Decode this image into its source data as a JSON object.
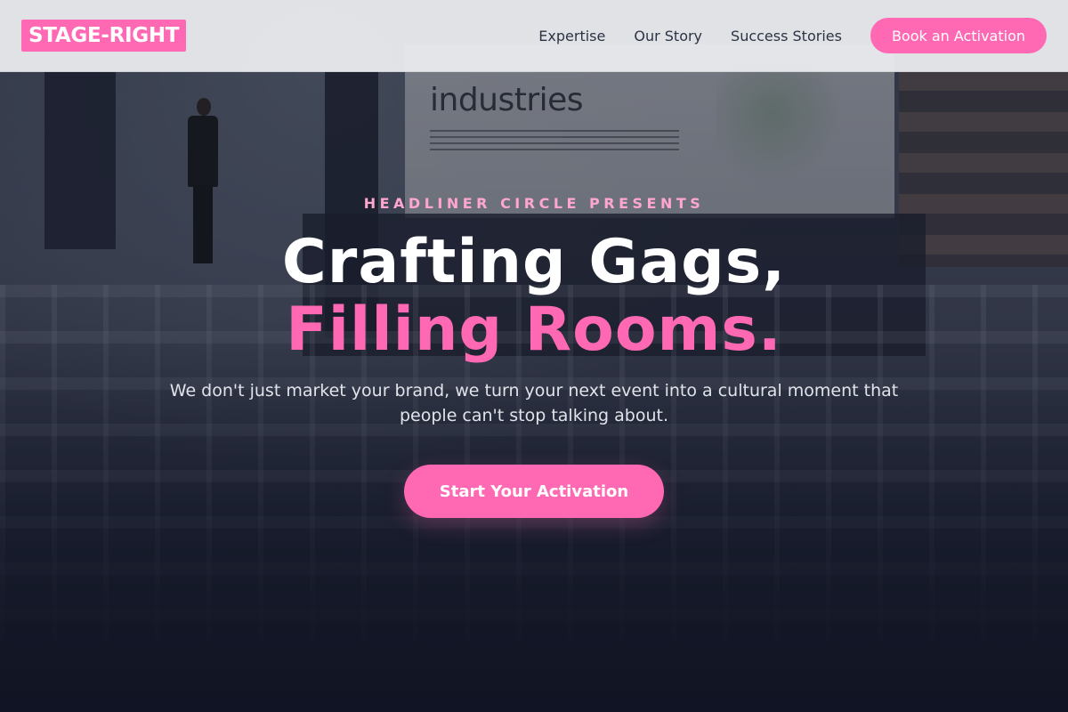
{
  "brand": {
    "logo_text": "STAGE-RIGHT",
    "accent_color": "#ff69b4"
  },
  "nav": {
    "links": [
      "Expertise",
      "Our Story",
      "Success Stories"
    ],
    "cta_label": "Book an Activation"
  },
  "hero": {
    "eyebrow": "HEADLINER CIRCLE PRESENTS",
    "headline_line_1": "Crafting Gags,",
    "headline_line_2": "Filling Rooms.",
    "subtitle": "We don't just market your brand, we turn your next event into a cultural moment that people can't stop talking about.",
    "cta_label": "Start Your Activation",
    "background_image_text": "industries"
  }
}
